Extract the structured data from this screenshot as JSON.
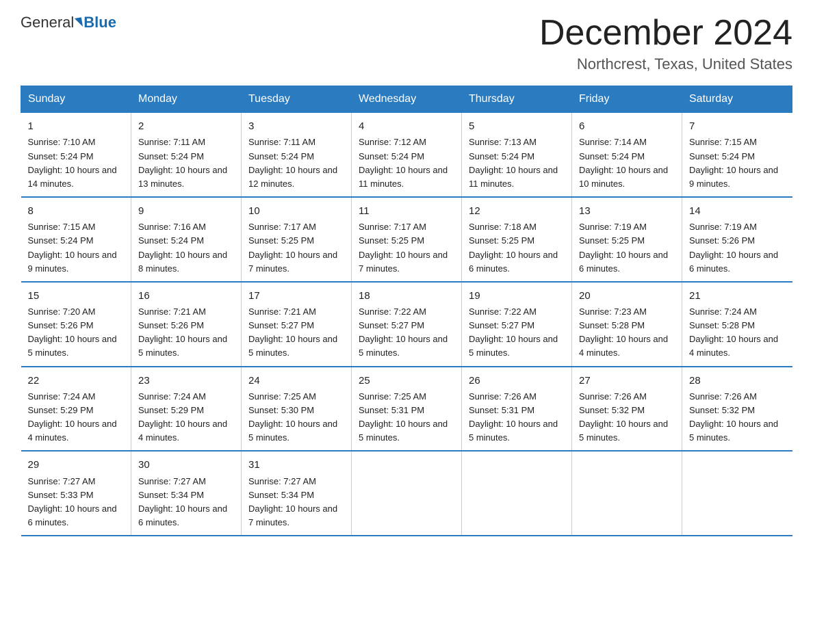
{
  "header": {
    "logo_general": "General",
    "logo_blue": "Blue",
    "month_year": "December 2024",
    "location": "Northcrest, Texas, United States"
  },
  "days_of_week": [
    "Sunday",
    "Monday",
    "Tuesday",
    "Wednesday",
    "Thursday",
    "Friday",
    "Saturday"
  ],
  "weeks": [
    [
      {
        "day": "1",
        "sunrise": "7:10 AM",
        "sunset": "5:24 PM",
        "daylight": "10 hours and 14 minutes."
      },
      {
        "day": "2",
        "sunrise": "7:11 AM",
        "sunset": "5:24 PM",
        "daylight": "10 hours and 13 minutes."
      },
      {
        "day": "3",
        "sunrise": "7:11 AM",
        "sunset": "5:24 PM",
        "daylight": "10 hours and 12 minutes."
      },
      {
        "day": "4",
        "sunrise": "7:12 AM",
        "sunset": "5:24 PM",
        "daylight": "10 hours and 11 minutes."
      },
      {
        "day": "5",
        "sunrise": "7:13 AM",
        "sunset": "5:24 PM",
        "daylight": "10 hours and 11 minutes."
      },
      {
        "day": "6",
        "sunrise": "7:14 AM",
        "sunset": "5:24 PM",
        "daylight": "10 hours and 10 minutes."
      },
      {
        "day": "7",
        "sunrise": "7:15 AM",
        "sunset": "5:24 PM",
        "daylight": "10 hours and 9 minutes."
      }
    ],
    [
      {
        "day": "8",
        "sunrise": "7:15 AM",
        "sunset": "5:24 PM",
        "daylight": "10 hours and 9 minutes."
      },
      {
        "day": "9",
        "sunrise": "7:16 AM",
        "sunset": "5:24 PM",
        "daylight": "10 hours and 8 minutes."
      },
      {
        "day": "10",
        "sunrise": "7:17 AM",
        "sunset": "5:25 PM",
        "daylight": "10 hours and 7 minutes."
      },
      {
        "day": "11",
        "sunrise": "7:17 AM",
        "sunset": "5:25 PM",
        "daylight": "10 hours and 7 minutes."
      },
      {
        "day": "12",
        "sunrise": "7:18 AM",
        "sunset": "5:25 PM",
        "daylight": "10 hours and 6 minutes."
      },
      {
        "day": "13",
        "sunrise": "7:19 AM",
        "sunset": "5:25 PM",
        "daylight": "10 hours and 6 minutes."
      },
      {
        "day": "14",
        "sunrise": "7:19 AM",
        "sunset": "5:26 PM",
        "daylight": "10 hours and 6 minutes."
      }
    ],
    [
      {
        "day": "15",
        "sunrise": "7:20 AM",
        "sunset": "5:26 PM",
        "daylight": "10 hours and 5 minutes."
      },
      {
        "day": "16",
        "sunrise": "7:21 AM",
        "sunset": "5:26 PM",
        "daylight": "10 hours and 5 minutes."
      },
      {
        "day": "17",
        "sunrise": "7:21 AM",
        "sunset": "5:27 PM",
        "daylight": "10 hours and 5 minutes."
      },
      {
        "day": "18",
        "sunrise": "7:22 AM",
        "sunset": "5:27 PM",
        "daylight": "10 hours and 5 minutes."
      },
      {
        "day": "19",
        "sunrise": "7:22 AM",
        "sunset": "5:27 PM",
        "daylight": "10 hours and 5 minutes."
      },
      {
        "day": "20",
        "sunrise": "7:23 AM",
        "sunset": "5:28 PM",
        "daylight": "10 hours and 4 minutes."
      },
      {
        "day": "21",
        "sunrise": "7:24 AM",
        "sunset": "5:28 PM",
        "daylight": "10 hours and 4 minutes."
      }
    ],
    [
      {
        "day": "22",
        "sunrise": "7:24 AM",
        "sunset": "5:29 PM",
        "daylight": "10 hours and 4 minutes."
      },
      {
        "day": "23",
        "sunrise": "7:24 AM",
        "sunset": "5:29 PM",
        "daylight": "10 hours and 4 minutes."
      },
      {
        "day": "24",
        "sunrise": "7:25 AM",
        "sunset": "5:30 PM",
        "daylight": "10 hours and 5 minutes."
      },
      {
        "day": "25",
        "sunrise": "7:25 AM",
        "sunset": "5:31 PM",
        "daylight": "10 hours and 5 minutes."
      },
      {
        "day": "26",
        "sunrise": "7:26 AM",
        "sunset": "5:31 PM",
        "daylight": "10 hours and 5 minutes."
      },
      {
        "day": "27",
        "sunrise": "7:26 AM",
        "sunset": "5:32 PM",
        "daylight": "10 hours and 5 minutes."
      },
      {
        "day": "28",
        "sunrise": "7:26 AM",
        "sunset": "5:32 PM",
        "daylight": "10 hours and 5 minutes."
      }
    ],
    [
      {
        "day": "29",
        "sunrise": "7:27 AM",
        "sunset": "5:33 PM",
        "daylight": "10 hours and 6 minutes."
      },
      {
        "day": "30",
        "sunrise": "7:27 AM",
        "sunset": "5:34 PM",
        "daylight": "10 hours and 6 minutes."
      },
      {
        "day": "31",
        "sunrise": "7:27 AM",
        "sunset": "5:34 PM",
        "daylight": "10 hours and 7 minutes."
      },
      {
        "day": "",
        "sunrise": "",
        "sunset": "",
        "daylight": ""
      },
      {
        "day": "",
        "sunrise": "",
        "sunset": "",
        "daylight": ""
      },
      {
        "day": "",
        "sunrise": "",
        "sunset": "",
        "daylight": ""
      },
      {
        "day": "",
        "sunrise": "",
        "sunset": "",
        "daylight": ""
      }
    ]
  ]
}
